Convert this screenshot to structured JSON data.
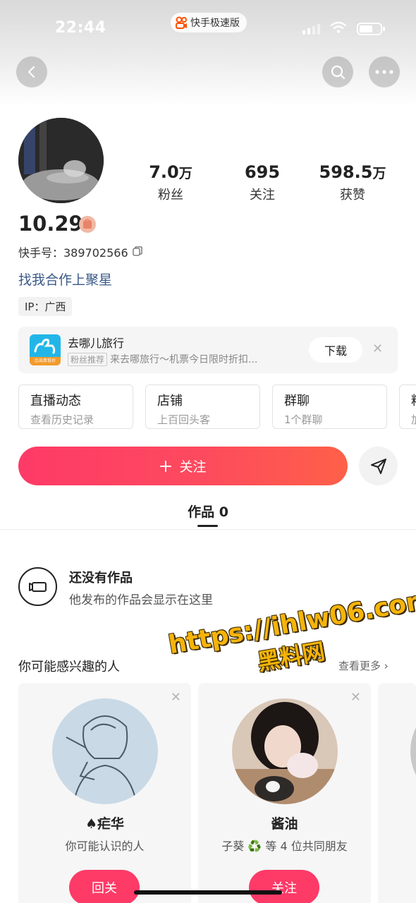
{
  "status_bar": {
    "time": "22:44",
    "app_name": "快手极速版"
  },
  "profile": {
    "stats": [
      {
        "value": "7.0",
        "unit": "万",
        "label": "粉丝"
      },
      {
        "value": "695",
        "unit": "",
        "label": "关注"
      },
      {
        "value": "598.5",
        "unit": "万",
        "label": "获赞"
      }
    ],
    "username": "10.29",
    "ks_id": "快手号：389702566",
    "coop_link": "找我合作上聚星",
    "ip": "IP：广西"
  },
  "ad": {
    "title": "去哪儿旅行",
    "tag": "粉丝推荐",
    "subtitle": "来去哪旅行～机票今日限时折扣...",
    "download_label": "下载",
    "logo_caption": "比出真低价"
  },
  "features": [
    {
      "title": "直播动态",
      "sub": "查看历史记录"
    },
    {
      "title": "店铺",
      "sub": "上百回头客"
    },
    {
      "title": "群聊",
      "sub": "1个群聊"
    },
    {
      "title": "粉",
      "sub": "加"
    }
  ],
  "actions": {
    "follow_label": "关注"
  },
  "tabs": {
    "works": "作品 0"
  },
  "empty": {
    "title": "还没有作品",
    "subtitle": "他发布的作品会显示在这里"
  },
  "recommend": {
    "title": "你可能感兴趣的人",
    "more": "查看更多",
    "cards": [
      {
        "name": "♠疟华",
        "desc": "你可能认识的人",
        "button": "回关"
      },
      {
        "name": "酱油",
        "desc": "子葵 ♻️ 等 4 位共同朋友",
        "button": "关注"
      }
    ]
  },
  "watermark": {
    "line1": "https://ihlw06.com",
    "line2": "黑料网"
  },
  "colors": {
    "accent": "#fe3a67",
    "link": "#3a5a88"
  }
}
